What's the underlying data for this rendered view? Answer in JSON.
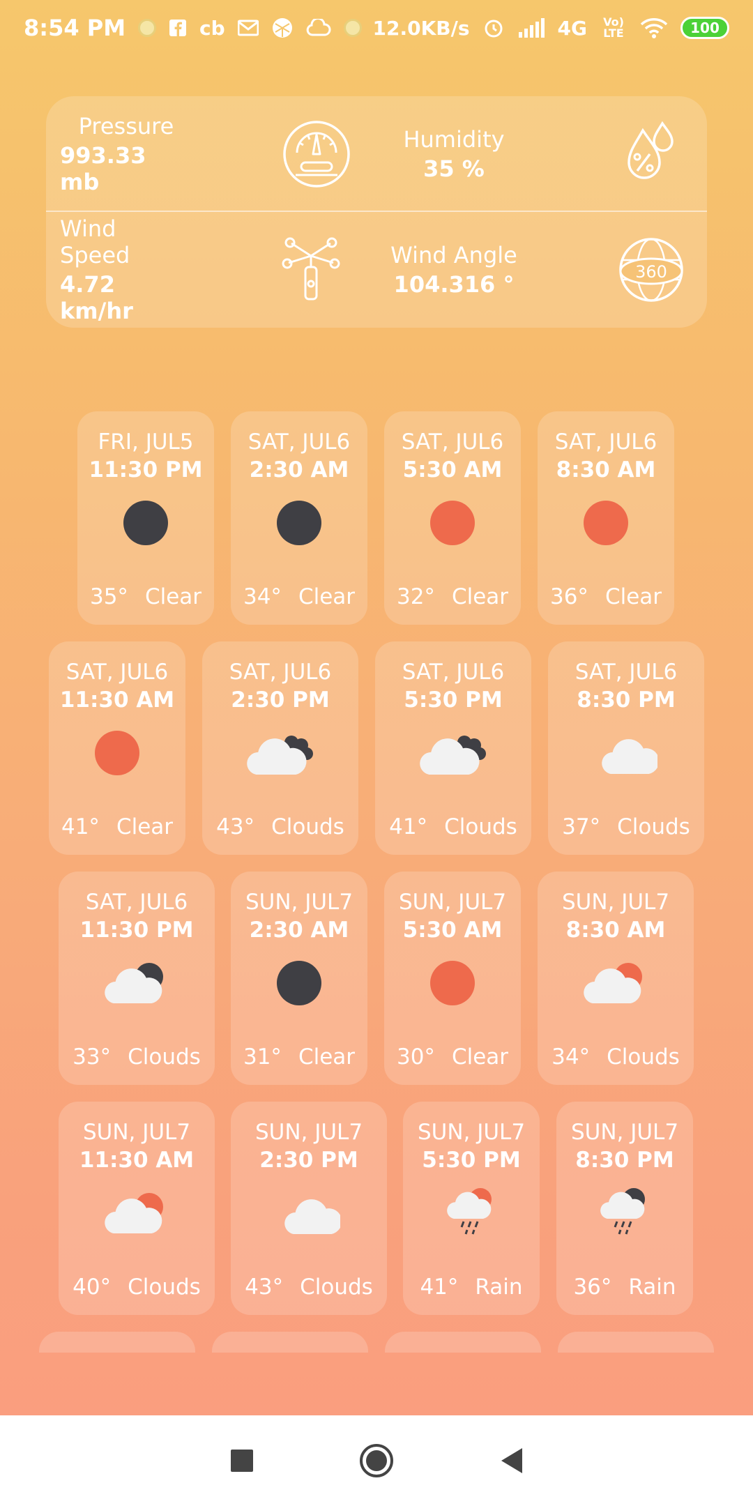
{
  "status_bar": {
    "time": "8:54 PM",
    "left_icons": [
      "sun-dot-icon",
      "facebook-icon",
      "cb-icon",
      "gmail-icon",
      "ball-icon",
      "cloud-icon",
      "sun-dot-icon"
    ],
    "cb_label": "cb",
    "net_speed": "12.0KB/s",
    "network": "4G",
    "volte": "Vo) LTE",
    "battery": "100"
  },
  "conditions": {
    "pressure": {
      "label": "Pressure",
      "value": "993.33 mb",
      "icon": "gauge-icon"
    },
    "humidity": {
      "label": "Humidity",
      "value": "35 %",
      "icon": "humidity-drops-icon"
    },
    "wind_speed": {
      "label": "Wind Speed",
      "value": "4.72 km/hr",
      "icon": "anemometer-icon"
    },
    "wind_angle": {
      "label": "Wind Angle",
      "value": "104.316 °",
      "icon": "globe-360-icon"
    }
  },
  "forecast": [
    {
      "date": "FRI, JUL5",
      "time": "11:30 PM",
      "temp": "35°",
      "cond": "Clear",
      "icon": "moon"
    },
    {
      "date": "SAT, JUL6",
      "time": "2:30 AM",
      "temp": "34°",
      "cond": "Clear",
      "icon": "moon"
    },
    {
      "date": "SAT, JUL6",
      "time": "5:30 AM",
      "temp": "32°",
      "cond": "Clear",
      "icon": "sun"
    },
    {
      "date": "SAT, JUL6",
      "time": "8:30 AM",
      "temp": "36°",
      "cond": "Clear",
      "icon": "sun"
    },
    {
      "date": "SAT, JUL6",
      "time": "11:30 AM",
      "temp": "41°",
      "cond": "Clear",
      "icon": "sun"
    },
    {
      "date": "SAT, JUL6",
      "time": "2:30 PM",
      "temp": "43°",
      "cond": "Clouds",
      "icon": "clouds-dark"
    },
    {
      "date": "SAT, JUL6",
      "time": "5:30 PM",
      "temp": "41°",
      "cond": "Clouds",
      "icon": "clouds-dark"
    },
    {
      "date": "SAT, JUL6",
      "time": "8:30 PM",
      "temp": "37°",
      "cond": "Clouds",
      "icon": "cloud"
    },
    {
      "date": "SAT, JUL6",
      "time": "11:30 PM",
      "temp": "33°",
      "cond": "Clouds",
      "icon": "cloud-moon"
    },
    {
      "date": "SUN, JUL7",
      "time": "2:30 AM",
      "temp": "31°",
      "cond": "Clear",
      "icon": "moon"
    },
    {
      "date": "SUN, JUL7",
      "time": "5:30 AM",
      "temp": "30°",
      "cond": "Clear",
      "icon": "sun"
    },
    {
      "date": "SUN, JUL7",
      "time": "8:30 AM",
      "temp": "34°",
      "cond": "Clouds",
      "icon": "cloud-sun"
    },
    {
      "date": "SUN, JUL7",
      "time": "11:30 AM",
      "temp": "40°",
      "cond": "Clouds",
      "icon": "cloud-sun"
    },
    {
      "date": "SUN, JUL7",
      "time": "2:30 PM",
      "temp": "43°",
      "cond": "Clouds",
      "icon": "cloud"
    },
    {
      "date": "SUN, JUL7",
      "time": "5:30 PM",
      "temp": "41°",
      "cond": "Rain",
      "icon": "rain-sun"
    },
    {
      "date": "SUN, JUL7",
      "time": "8:30 PM",
      "temp": "36°",
      "cond": "Rain",
      "icon": "rain-moon"
    }
  ],
  "colors": {
    "moon": "#3f3f44",
    "sun": "#ee6a4c",
    "cloud": "#f2f2f2"
  },
  "nav": {
    "recents": "square-icon",
    "home": "circle-icon",
    "back": "triangle-back-icon"
  }
}
